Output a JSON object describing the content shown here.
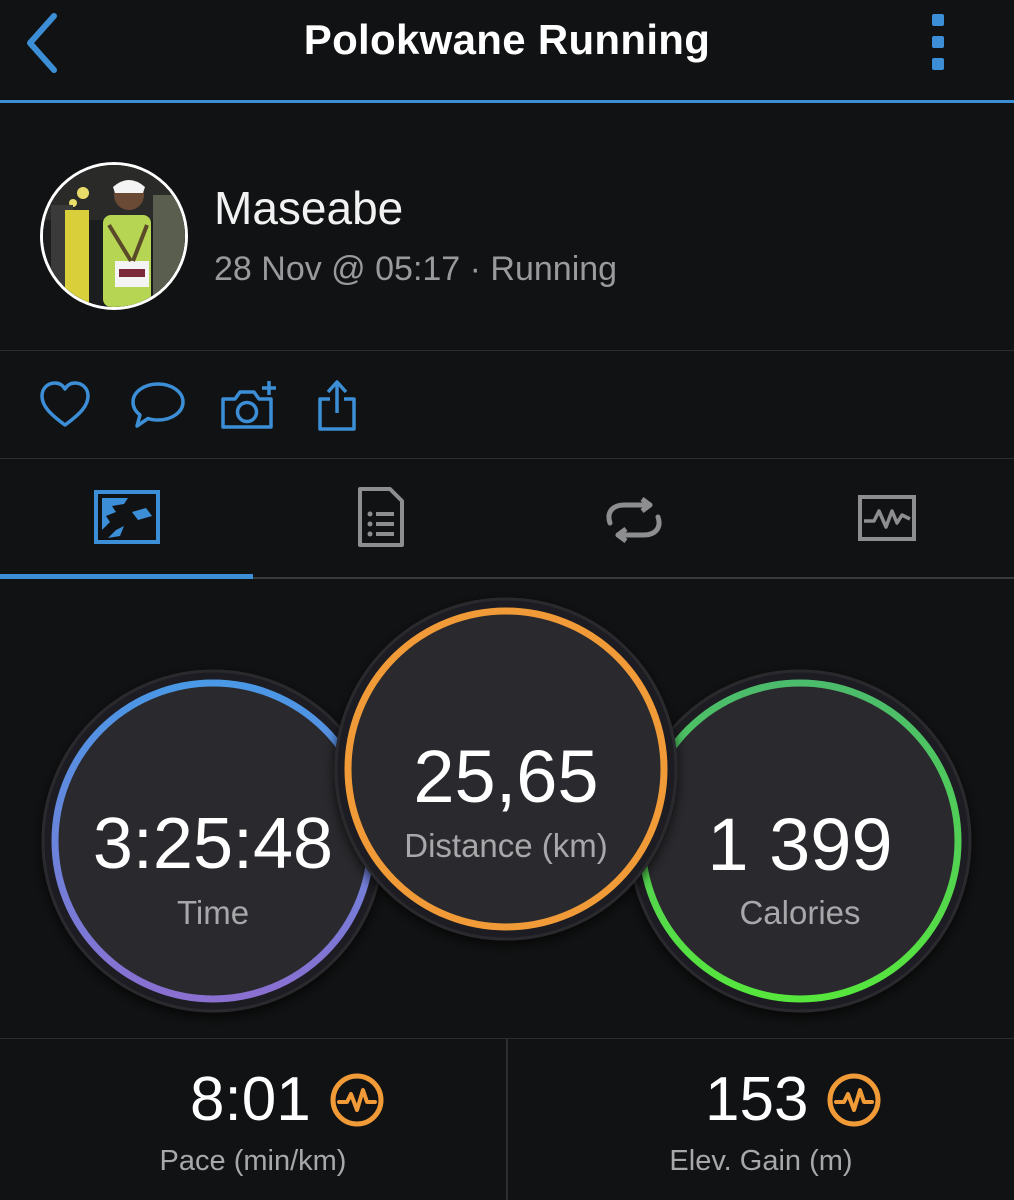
{
  "header": {
    "title": "Polokwane Running",
    "back_icon": "chevron-left-icon",
    "menu_icon": "more-vertical-icon"
  },
  "profile": {
    "name": "Maseabe",
    "meta": "28 Nov @ 05:17 · Running"
  },
  "actions": [
    {
      "icon": "heart-icon"
    },
    {
      "icon": "comment-icon"
    },
    {
      "icon": "add-photo-icon"
    },
    {
      "icon": "share-icon"
    }
  ],
  "tabs": [
    {
      "icon": "map-icon",
      "active": true
    },
    {
      "icon": "document-list-icon",
      "active": false
    },
    {
      "icon": "repeat-icon",
      "active": false
    },
    {
      "icon": "chart-icon",
      "active": false
    }
  ],
  "stats": {
    "time": {
      "value": "3:25:48",
      "label": "Time"
    },
    "distance": {
      "value": "25,65",
      "label": "Distance (km)"
    },
    "calories": {
      "value": "1 399",
      "label": "Calories"
    }
  },
  "bottom_stats": {
    "pace": {
      "value": "8:01",
      "label": "Pace (min/km)",
      "icon": "heart-rate-icon"
    },
    "elevation": {
      "value": "153",
      "label": "Elev. Gain (m)",
      "icon": "heart-rate-icon"
    }
  },
  "colors": {
    "accent": "#3c8fd6",
    "time_ring_start": "#4a98e6",
    "time_ring_end": "#8a6fd1",
    "distance_ring": "#f19a38",
    "calories_ring_start": "#4cbb6c",
    "calories_ring_end": "#57e63d",
    "icon_orange": "#f19a38"
  }
}
